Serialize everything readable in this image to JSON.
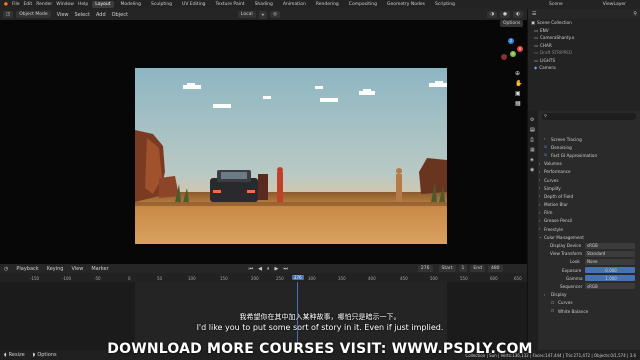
{
  "topbar": {
    "menus": [
      "File",
      "Edit",
      "Render",
      "Window",
      "Help"
    ],
    "workspaces": [
      "Layout",
      "Modeling",
      "Sculpting",
      "UV Editing",
      "Texture Paint",
      "Shading",
      "Animation",
      "Rendering",
      "Compositing",
      "Geometry Nodes",
      "Scripting"
    ],
    "scene": "Scene",
    "view_layer": "ViewLayer"
  },
  "viewport": {
    "mode": "Object Mode",
    "menus": [
      "View",
      "Select",
      "Add",
      "Object"
    ],
    "transform": "Local",
    "options": "Options"
  },
  "outliner": {
    "title": "Scene Collection",
    "items": [
      "ENV",
      "CameraShardy.o",
      "CHAR",
      "Draft STRIPPED",
      "LIGHTS",
      "Camera"
    ]
  },
  "properties": {
    "search_placeholder": "",
    "sections": [
      {
        "label": "Screen Tracing",
        "type": "sub"
      },
      {
        "label": "Denoising",
        "type": "check"
      },
      {
        "label": "Fast GI Approximation",
        "type": "check"
      },
      {
        "label": "Volumes",
        "type": "head"
      },
      {
        "label": "Performance",
        "type": "head"
      },
      {
        "label": "Curves",
        "type": "head"
      },
      {
        "label": "Simplify",
        "type": "head"
      },
      {
        "label": "Depth of Field",
        "type": "head"
      },
      {
        "label": "Motion Blur",
        "type": "head"
      },
      {
        "label": "Film",
        "type": "head"
      },
      {
        "label": "Grease Pencil",
        "type": "head"
      },
      {
        "label": "Freestyle",
        "type": "head"
      },
      {
        "label": "Color Management",
        "type": "open"
      }
    ],
    "color": {
      "display_device_label": "Display Device",
      "display_device": "sRGB",
      "view_transform_label": "View Transform",
      "view_transform": "Standard",
      "look_label": "Look",
      "look": "None",
      "exposure_label": "Exposure",
      "exposure": "0.000",
      "gamma_label": "Gamma",
      "gamma": "1.000",
      "sequencer_label": "Sequencer",
      "sequencer": "sRGB"
    },
    "bottom": [
      "Display",
      "Curves",
      "White Balance"
    ]
  },
  "timeline": {
    "menus": [
      "Playback",
      "Keying",
      "View",
      "Marker"
    ],
    "current_frame": "276",
    "start_label": "Start",
    "start": "1",
    "end_label": "End",
    "end": "480",
    "ticks": [
      "-150",
      "-100",
      "-50",
      "0",
      "50",
      "100",
      "150",
      "200",
      "250",
      "276",
      "300",
      "350",
      "400",
      "450",
      "500",
      "550",
      "600",
      "650"
    ]
  },
  "status": {
    "left": [
      "Resize",
      "Options"
    ],
    "right": "Collection | Sun | Verts:136,132 | Faces:147,444 | Tris:271,472 | Objects:0/1,574 | 3.6"
  },
  "subtitles": {
    "zh": "我希望你在其中加入某种故事，哪怕只是暗示一下。",
    "en": "I'd like you to put some sort of story in it. Even if just implied."
  },
  "watermark": "DOWNLOAD MORE COURSES VISIT: WWW.PSDLY.COM",
  "colors": {
    "accent": "#4772b3",
    "sky_top": "#8fb7c4",
    "ground": "#c98a45"
  }
}
